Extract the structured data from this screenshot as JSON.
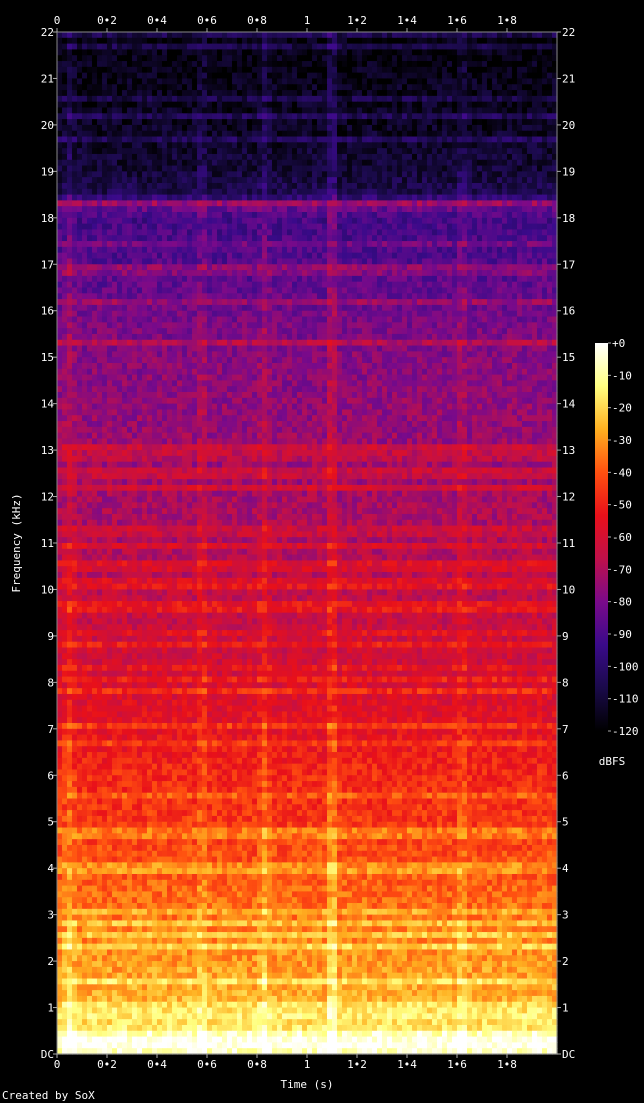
{
  "chart_data": {
    "type": "heatmap",
    "title": "",
    "xlabel": "Time (s)",
    "ylabel": "Frequency (kHz)",
    "xlim": [
      0,
      2.0
    ],
    "ylim": [
      0,
      22
    ],
    "x_ticks": [
      {
        "value": 0,
        "label": "0"
      },
      {
        "value": 0.2,
        "label": "0•2"
      },
      {
        "value": 0.4,
        "label": "0•4"
      },
      {
        "value": 0.6,
        "label": "0•6"
      },
      {
        "value": 0.8,
        "label": "0•8"
      },
      {
        "value": 1.0,
        "label": "1"
      },
      {
        "value": 1.2,
        "label": "1•2"
      },
      {
        "value": 1.4,
        "label": "1•4"
      },
      {
        "value": 1.6,
        "label": "1•6"
      },
      {
        "value": 1.8,
        "label": "1•8"
      }
    ],
    "y_ticks": [
      {
        "value": 0,
        "label": "DC"
      },
      {
        "value": 1,
        "label": "1"
      },
      {
        "value": 2,
        "label": "2"
      },
      {
        "value": 3,
        "label": "3"
      },
      {
        "value": 4,
        "label": "4"
      },
      {
        "value": 5,
        "label": "5"
      },
      {
        "value": 6,
        "label": "6"
      },
      {
        "value": 7,
        "label": "7"
      },
      {
        "value": 8,
        "label": "8"
      },
      {
        "value": 9,
        "label": "9"
      },
      {
        "value": 10,
        "label": "10"
      },
      {
        "value": 11,
        "label": "11"
      },
      {
        "value": 12,
        "label": "12"
      },
      {
        "value": 13,
        "label": "13"
      },
      {
        "value": 14,
        "label": "14"
      },
      {
        "value": 15,
        "label": "15"
      },
      {
        "value": 16,
        "label": "16"
      },
      {
        "value": 17,
        "label": "17"
      },
      {
        "value": 18,
        "label": "18"
      },
      {
        "value": 19,
        "label": "19"
      },
      {
        "value": 20,
        "label": "20"
      },
      {
        "value": 21,
        "label": "21"
      },
      {
        "value": 22,
        "label": "22"
      }
    ],
    "colorbar": {
      "label": "dBFS",
      "range": [
        -120,
        0
      ],
      "ticks": [
        {
          "value": 0,
          "label": "+0"
        },
        {
          "value": -10,
          "label": "-10"
        },
        {
          "value": -20,
          "label": "-20"
        },
        {
          "value": -30,
          "label": "-30"
        },
        {
          "value": -40,
          "label": "-40"
        },
        {
          "value": -50,
          "label": "-50"
        },
        {
          "value": -60,
          "label": "-60"
        },
        {
          "value": -70,
          "label": "-70"
        },
        {
          "value": -80,
          "label": "-80"
        },
        {
          "value": -90,
          "label": "-90"
        },
        {
          "value": -100,
          "label": "-100"
        },
        {
          "value": -110,
          "label": "-110"
        },
        {
          "value": -120,
          "label": "-120"
        }
      ],
      "colors": [
        "#000000",
        "#1a0a4a",
        "#3a0a8a",
        "#7a0a8a",
        "#c0104a",
        "#e8101a",
        "#ff5010",
        "#ffb020",
        "#ffff80",
        "#ffffff"
      ]
    },
    "level_profile_kHz_dBFS": [
      [
        0,
        -5
      ],
      [
        0.5,
        -15
      ],
      [
        1,
        -25
      ],
      [
        2,
        -30
      ],
      [
        3,
        -35
      ],
      [
        4,
        -40
      ],
      [
        5,
        -45
      ],
      [
        6,
        -48
      ],
      [
        7,
        -55
      ],
      [
        8,
        -60
      ],
      [
        9,
        -63
      ],
      [
        10,
        -66
      ],
      [
        11,
        -70
      ],
      [
        12,
        -72
      ],
      [
        13,
        -74
      ],
      [
        14,
        -76
      ],
      [
        15,
        -78
      ],
      [
        16,
        -82
      ],
      [
        17,
        -88
      ],
      [
        18,
        -92
      ],
      [
        18.3,
        -80
      ],
      [
        18.5,
        -105
      ],
      [
        19,
        -110
      ],
      [
        20,
        -114
      ],
      [
        22,
        -118
      ]
    ],
    "transients_s": [
      0.05,
      0.58,
      0.83,
      1.1,
      1.62
    ]
  },
  "footer": {
    "credit": "Created by SoX"
  }
}
